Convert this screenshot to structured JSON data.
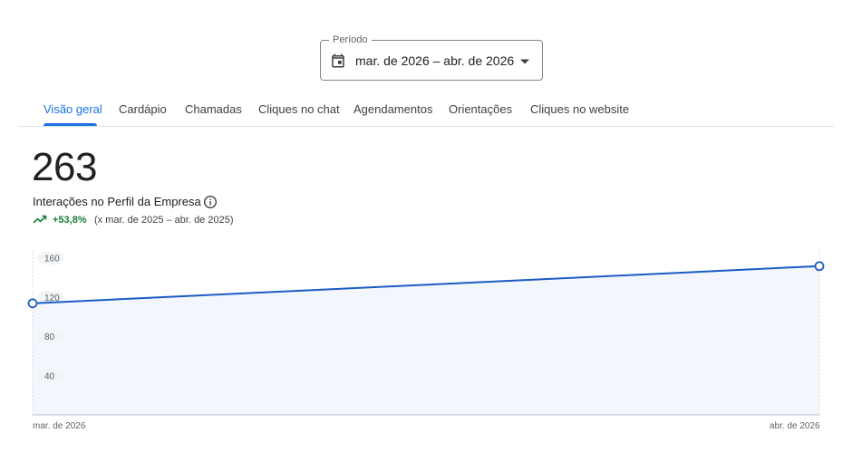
{
  "period": {
    "label": "Período",
    "value": "mar. de 2026 – abr. de 2026"
  },
  "tabs": [
    {
      "label": "Visão geral",
      "active": true
    },
    {
      "label": "Cardápio",
      "active": false
    },
    {
      "label": "Chamadas",
      "active": false
    },
    {
      "label": "Cliques no chat",
      "active": false
    },
    {
      "label": "Agendamentos",
      "active": false
    },
    {
      "label": "Orientações",
      "active": false
    },
    {
      "label": "Cliques no website",
      "active": false
    }
  ],
  "metric": {
    "value": "263",
    "label": "Interações no Perfil da Empresa",
    "change": "+53,8%",
    "comparison": "(x mar. de 2025 – abr. de 2025)"
  },
  "colors": {
    "accent": "#1a73e8",
    "line": "#1a5cc4",
    "area": "#f3f6fd",
    "positive": "#188038"
  },
  "icons": [
    "calendar-icon",
    "caret-down-icon",
    "info-icon",
    "trending-up-icon"
  ],
  "chart_data": {
    "type": "area",
    "x": [
      "mar. de 2026",
      "abr. de 2026"
    ],
    "series": [
      {
        "values": [
          114,
          152
        ]
      }
    ],
    "yticks": [
      160,
      120,
      80,
      40
    ],
    "ylim": [
      0,
      174
    ],
    "xlabel": "",
    "ylabel": "",
    "grid": false
  }
}
